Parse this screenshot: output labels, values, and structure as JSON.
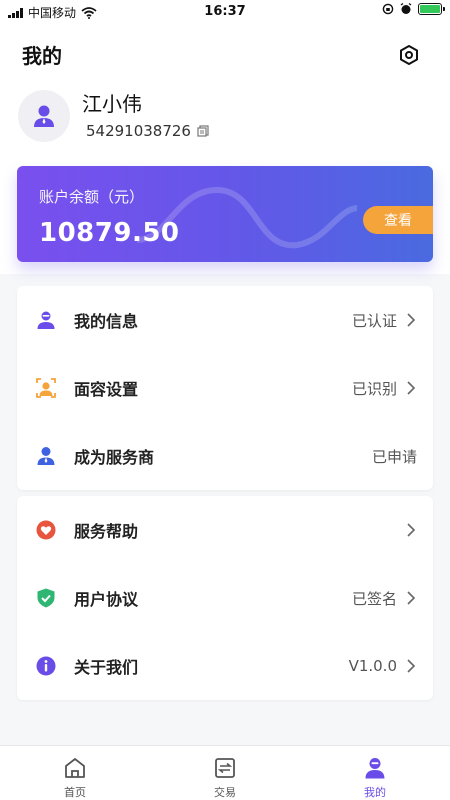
{
  "status_bar": {
    "carrier": "中国移动",
    "time": "16:37"
  },
  "header": {
    "title": "我的"
  },
  "user": {
    "name": "江小伟",
    "id": "54291038726"
  },
  "balance": {
    "label": "账户余额（元）",
    "amount": "10879.50",
    "view_label": "查看"
  },
  "menu_group_1": [
    {
      "label": "我的信息",
      "value": "已认证",
      "icon": "user-icon"
    },
    {
      "label": "面容设置",
      "value": "已识别",
      "icon": "face-scan-icon"
    },
    {
      "label": "成为服务商",
      "value": "已申请",
      "icon": "service-provider-icon"
    }
  ],
  "menu_group_2": [
    {
      "label": "服务帮助",
      "value": "",
      "icon": "heart-icon"
    },
    {
      "label": "用户协议",
      "value": "已签名",
      "icon": "shield-check-icon"
    },
    {
      "label": "关于我们",
      "value": "V1.0.0",
      "icon": "info-icon"
    }
  ],
  "tabs": [
    {
      "label": "首页",
      "icon": "home-icon"
    },
    {
      "label": "交易",
      "icon": "trade-icon"
    },
    {
      "label": "我的",
      "icon": "profile-icon",
      "active": true
    }
  ],
  "colors": {
    "accent": "#6a4de8",
    "orange": "#f5a33b",
    "red": "#e8553f",
    "green": "#2fb673",
    "blue": "#3f63e0"
  }
}
